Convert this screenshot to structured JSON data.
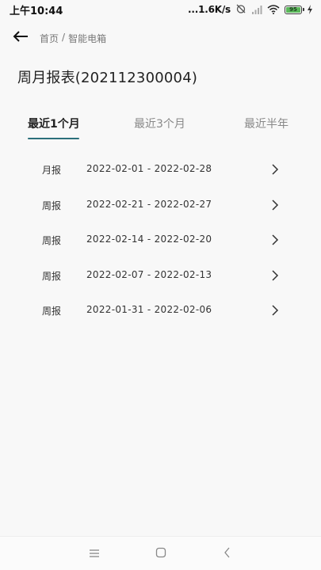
{
  "status_bar": {
    "time": "上午10:44",
    "net_speed": "...1.6K/s",
    "battery": "95"
  },
  "header": {
    "breadcrumb": [
      "首页",
      "/",
      "智能电箱"
    ]
  },
  "page": {
    "title": "周月报表(202112300004)"
  },
  "tabs": [
    {
      "label": "最近1个月",
      "active": true
    },
    {
      "label": "最近3个月",
      "active": false
    },
    {
      "label": "最近半年",
      "active": false
    }
  ],
  "reports": [
    {
      "type": "月报",
      "range": "2022-02-01 - 2022-02-28"
    },
    {
      "type": "周报",
      "range": "2022-02-21 - 2022-02-27"
    },
    {
      "type": "周报",
      "range": "2022-02-14 - 2022-02-20"
    },
    {
      "type": "周报",
      "range": "2022-02-07 - 2022-02-13"
    },
    {
      "type": "周报",
      "range": "2022-01-31 - 2022-02-06"
    }
  ],
  "icons": {
    "back": "arrow-left-icon",
    "row_arrow": "chevron-right-icon",
    "menu": "menu-icon",
    "home": "home-square-icon",
    "back_nav": "chevron-left-icon"
  },
  "colors": {
    "accent": "#2b6f7a",
    "background": "#f8f8f8"
  }
}
